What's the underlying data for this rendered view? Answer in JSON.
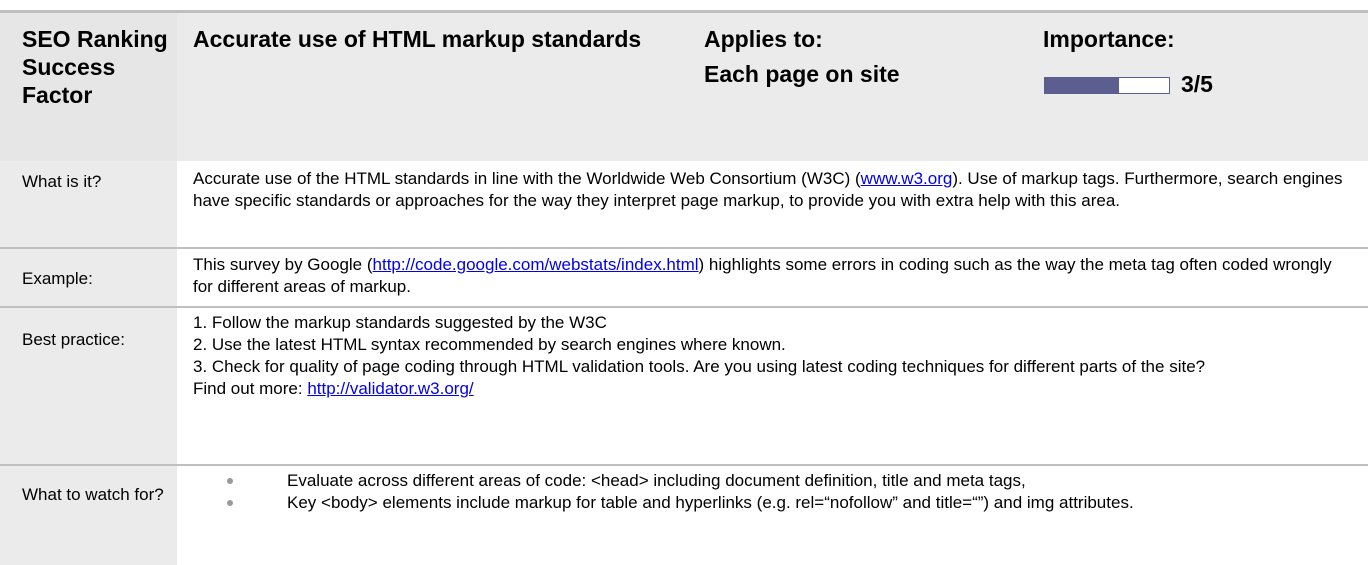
{
  "header": {
    "label": "SEO Ranking Success Factor",
    "factor_title": "Accurate use of HTML markup standards",
    "applies_heading": "Applies to:",
    "applies_value": "Each page on site",
    "importance_heading": "Importance:",
    "importance_score": "3/5",
    "importance_fraction": 0.6,
    "bar_color": "#5c5e8f"
  },
  "what_is_it": {
    "label": "What is it?",
    "text_before": "Accurate use of the HTML standards in line with the Worldwide Web Consortium (W3C) (",
    "link": "www.w3.org",
    "text_after": "). Use of markup tags. Furthermore, search engines have specific standards or approaches for the way they interpret page markup, to provide you with extra help with this area."
  },
  "example": {
    "label": "Example:",
    "text_before": "This survey by Google (",
    "link": "http://code.google.com/webstats/index.html",
    "text_after": ") highlights some errors in coding such as the way the meta tag often coded wrongly for different areas of markup."
  },
  "best_practice": {
    "label": "Best practice:",
    "lines": [
      "1. Follow the markup standards suggested by the W3C",
      "2. Use the latest HTML syntax recommended by search engines where known.",
      "3. Check for quality of page coding through HTML validation tools. Are you using latest coding techniques for different parts of the site?"
    ],
    "find_out_more": "Find out more: ",
    "link": "http://validator.w3.org/"
  },
  "watch_for": {
    "label": "What to watch for?",
    "bullets": [
      "Evaluate across different areas of code: <head> including document definition, title and meta tags,",
      "Key <body> elements include markup for table and hyperlinks (e.g. rel=“nofollow” and title=“”) and img attributes."
    ]
  }
}
